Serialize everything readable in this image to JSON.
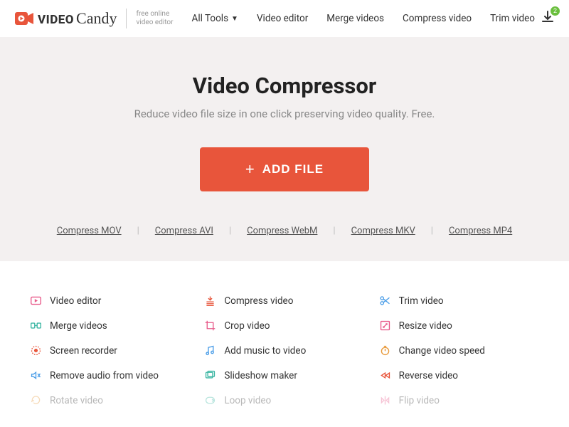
{
  "brand": {
    "word1": "VIDEO",
    "word2": "Candy",
    "tagline1": "free online",
    "tagline2": "video editor"
  },
  "nav": {
    "allTools": "All Tools",
    "videoEditor": "Video editor",
    "merge": "Merge videos",
    "compress": "Compress video",
    "trim": "Trim video",
    "dlBadge": "2"
  },
  "hero": {
    "title": "Video Compressor",
    "subtitle": "Reduce video file size in one click preserving video quality. Free.",
    "addBtn": "ADD FILE"
  },
  "formats": {
    "mov": "Compress MOV",
    "avi": "Compress AVI",
    "webm": "Compress WebM",
    "mkv": "Compress MKV",
    "mp4": "Compress MP4"
  },
  "tools": {
    "editor": "Video editor",
    "compress": "Compress video",
    "trim": "Trim video",
    "merge": "Merge videos",
    "crop": "Crop video",
    "resize": "Resize video",
    "screen": "Screen recorder",
    "music": "Add music to video",
    "speed": "Change video speed",
    "removeAudio": "Remove audio from video",
    "slideshow": "Slideshow maker",
    "reverse": "Reverse video",
    "rotate": "Rotate video",
    "loop": "Loop video",
    "flip": "Flip video"
  },
  "colors": {
    "accent": "#e8553b",
    "green": "#6abf3d",
    "teal": "#3bb6a3",
    "blue": "#4a9de8",
    "orange": "#e89a3b",
    "pink": "#e85a8a"
  }
}
